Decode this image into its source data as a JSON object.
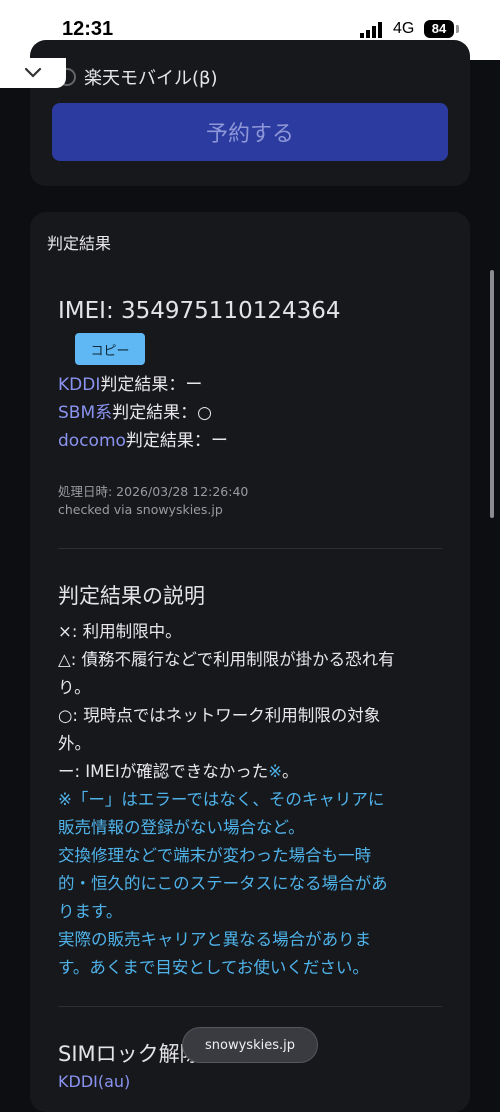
{
  "status_bar": {
    "time": "12:31",
    "network": "4G",
    "battery": "84"
  },
  "reservation": {
    "carrier_option": "楽天モバイル(β)",
    "reserve_label": "予約する"
  },
  "result": {
    "section_title": "判定結果",
    "imei_label": "IMEI: 354975110124364",
    "copy_label": "コピー",
    "lines": [
      {
        "carrier": "KDDI",
        "suffix": "判定結果：ー"
      },
      {
        "carrier": "SBM系",
        "suffix": "判定結果：○"
      },
      {
        "carrier": "docomo",
        "suffix": "判定結果：ー"
      }
    ],
    "processed_at": "処理日時: 2026/03/28 12:26:40",
    "checked_via": "checked via snowyskies.jp"
  },
  "explanation": {
    "title": "判定結果の説明",
    "lines": [
      "×: 利用制限中。",
      "△: 債務不履行などで利用制限が掛かる恐れ有",
      "り。",
      "○: 現時点ではネットワーク利用制限の対象",
      "外。"
    ],
    "dash_line": "ー: IMEIが確認できなかった",
    "dash_mark": "※",
    "dash_end": "。",
    "notes": [
      "※「ー」はエラーではなく、そのキャリアに",
      "販売情報の登録がない場合など。",
      "交換修理などで端末が変わった場合も一時",
      "的・恒久的にこのステータスになる場合があ",
      "ります。",
      "実際の販売キャリアと異なる場合がありま",
      "す。あくまで目安としてお使いください。"
    ]
  },
  "sim_lock": {
    "title": "SIMロック解除可否判定",
    "sub": "KDDI(au)"
  },
  "toast": "snowyskies.jp",
  "colors": {
    "background": "#0d0e12",
    "card": "#17181c",
    "reserve_button": "#2b3ba0",
    "copy_button": "#5fb8f4",
    "carrier_link": "#8a93f0",
    "note_blue": "#4fb3ea"
  }
}
